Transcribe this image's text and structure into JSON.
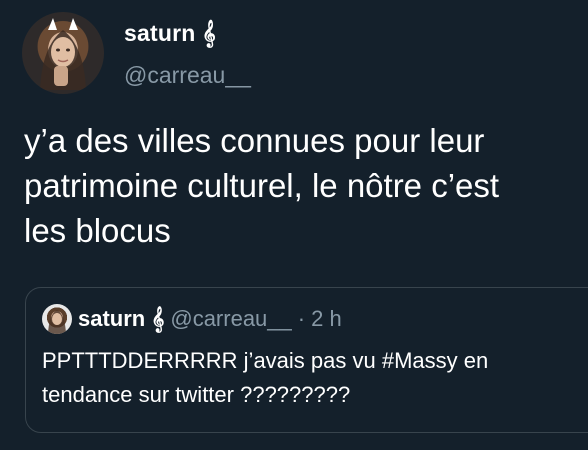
{
  "tweet": {
    "display_name": "saturn 𝄞",
    "handle": "@carreau__",
    "text_lines": [
      "y’a des villes connues pour leur",
      "patrimoine culturel, le nôtre c’est",
      "les blocus"
    ]
  },
  "quoted_tweet": {
    "display_name": "saturn 𝄞",
    "handle": "@carreau__",
    "separator": "·",
    "time": "2 h",
    "text_lines": [
      "PPTTTDDERRRRR j’avais pas vu #Massy en",
      "tendance sur twitter ?????????"
    ]
  },
  "colors": {
    "background": "#14202b",
    "secondary_text": "#8899a6",
    "border": "#38444d"
  }
}
